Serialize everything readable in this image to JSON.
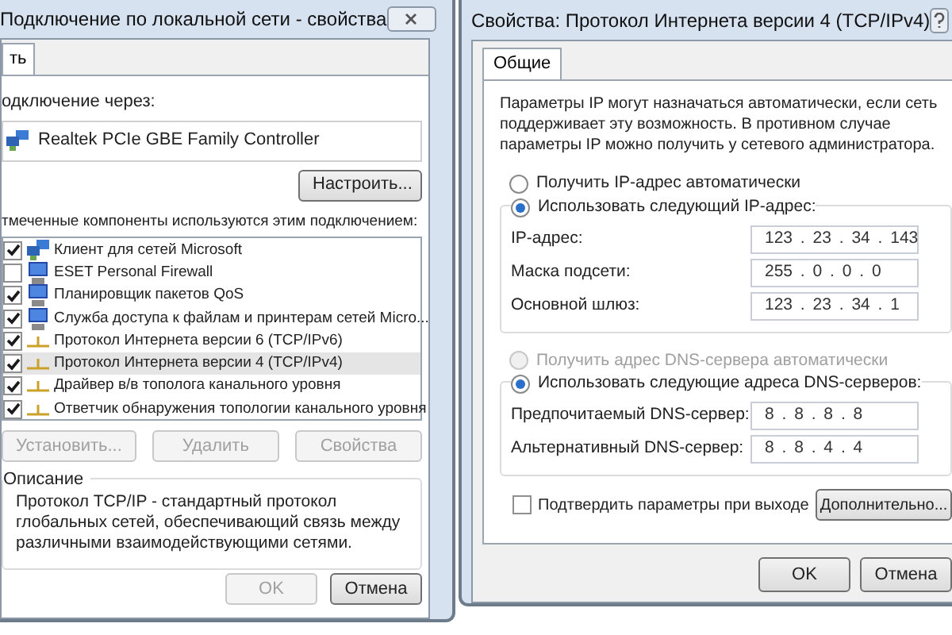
{
  "left_window": {
    "title": "Подключение по локальной сети - свойства",
    "tab": {
      "label": "ть",
      "selected": true
    },
    "connect_via_label": "одключение через:",
    "adapter": "Realtek PCIe GBE Family Controller",
    "configure_button": "Настроить...",
    "components_label": "тмеченные компоненты используются этим подключением:",
    "components": [
      {
        "kind": "client",
        "label": "Клиент для сетей Microsoft",
        "checked": true,
        "selected": false
      },
      {
        "kind": "service",
        "label": "ESET Personal Firewall",
        "checked": false,
        "selected": false
      },
      {
        "kind": "service",
        "label": "Планировщик пакетов QoS",
        "checked": true,
        "selected": false
      },
      {
        "kind": "service",
        "label": "Служба доступа к файлам и принтерам сетей Micro...",
        "checked": true,
        "selected": false
      },
      {
        "kind": "protocol",
        "label": "Протокол Интернета версии 6 (TCP/IPv6)",
        "checked": true,
        "selected": false
      },
      {
        "kind": "protocol",
        "label": "Протокол Интернета версии 4 (TCP/IPv4)",
        "checked": true,
        "selected": true
      },
      {
        "kind": "protocol",
        "label": "Драйвер в/в тополога канального уровня",
        "checked": true,
        "selected": false
      },
      {
        "kind": "protocol",
        "label": "Ответчик обнаружения топологии канального уровня",
        "checked": true,
        "selected": false
      }
    ],
    "buttons": [
      {
        "label": "Установить...",
        "disabled": true
      },
      {
        "label": "Удалить",
        "disabled": true
      },
      {
        "label": "Свойства",
        "disabled": true
      }
    ],
    "description": {
      "title": "Описание",
      "text": "Протокол TCP/IP - стандартный протокол глобальных сетей, обеспечивающий связь между различными взаимодействующими сетями."
    },
    "footer_buttons": [
      {
        "label": "OK",
        "disabled": true
      },
      {
        "label": "Отмена",
        "disabled": false
      }
    ]
  },
  "right_window": {
    "title": "Свойства: Протокол Интернета версии 4 (TCP/IPv4)",
    "tab": {
      "label": "Общие",
      "selected": true
    },
    "intro": "Параметры IP могут назначаться автоматически, если сеть поддерживает эту возможность. В противном случае параметры IP можно получить у сетевого администратора.",
    "ip_auto": {
      "label": "Получить IP-адрес автоматически",
      "selected": false,
      "disabled": false
    },
    "ip_manual": {
      "label": "Использовать следующий IP-адрес:",
      "selected": true,
      "disabled": false
    },
    "ip_fields": [
      {
        "label": "IP-адрес:",
        "value": "123 . 23 . 34 . 143"
      },
      {
        "label": "Маска подсети:",
        "value": "255 . 0 . 0 . 0"
      },
      {
        "label": "Основной шлюз:",
        "value": "123 . 23 . 34 . 1"
      }
    ],
    "dns_auto": {
      "label": "Получить адрес DNS-сервера автоматически",
      "selected": false,
      "disabled": true
    },
    "dns_manual": {
      "label": "Использовать следующие адреса DNS-серверов:",
      "selected": true,
      "disabled": false
    },
    "dns_fields": [
      {
        "label": "Предпочитаемый DNS-сервер:",
        "value": "8 . 8 . 8 . 8"
      },
      {
        "label": "Альтернативный DNS-сервер:",
        "value": "8 . 8 . 4 . 4"
      }
    ],
    "confirm": {
      "label": "Подтвердить параметры при выходе",
      "checked": false
    },
    "advanced_button": "Дополнительно...",
    "footer_buttons": [
      {
        "label": "OK",
        "disabled": false
      },
      {
        "label": "Отмена",
        "disabled": false
      }
    ]
  }
}
